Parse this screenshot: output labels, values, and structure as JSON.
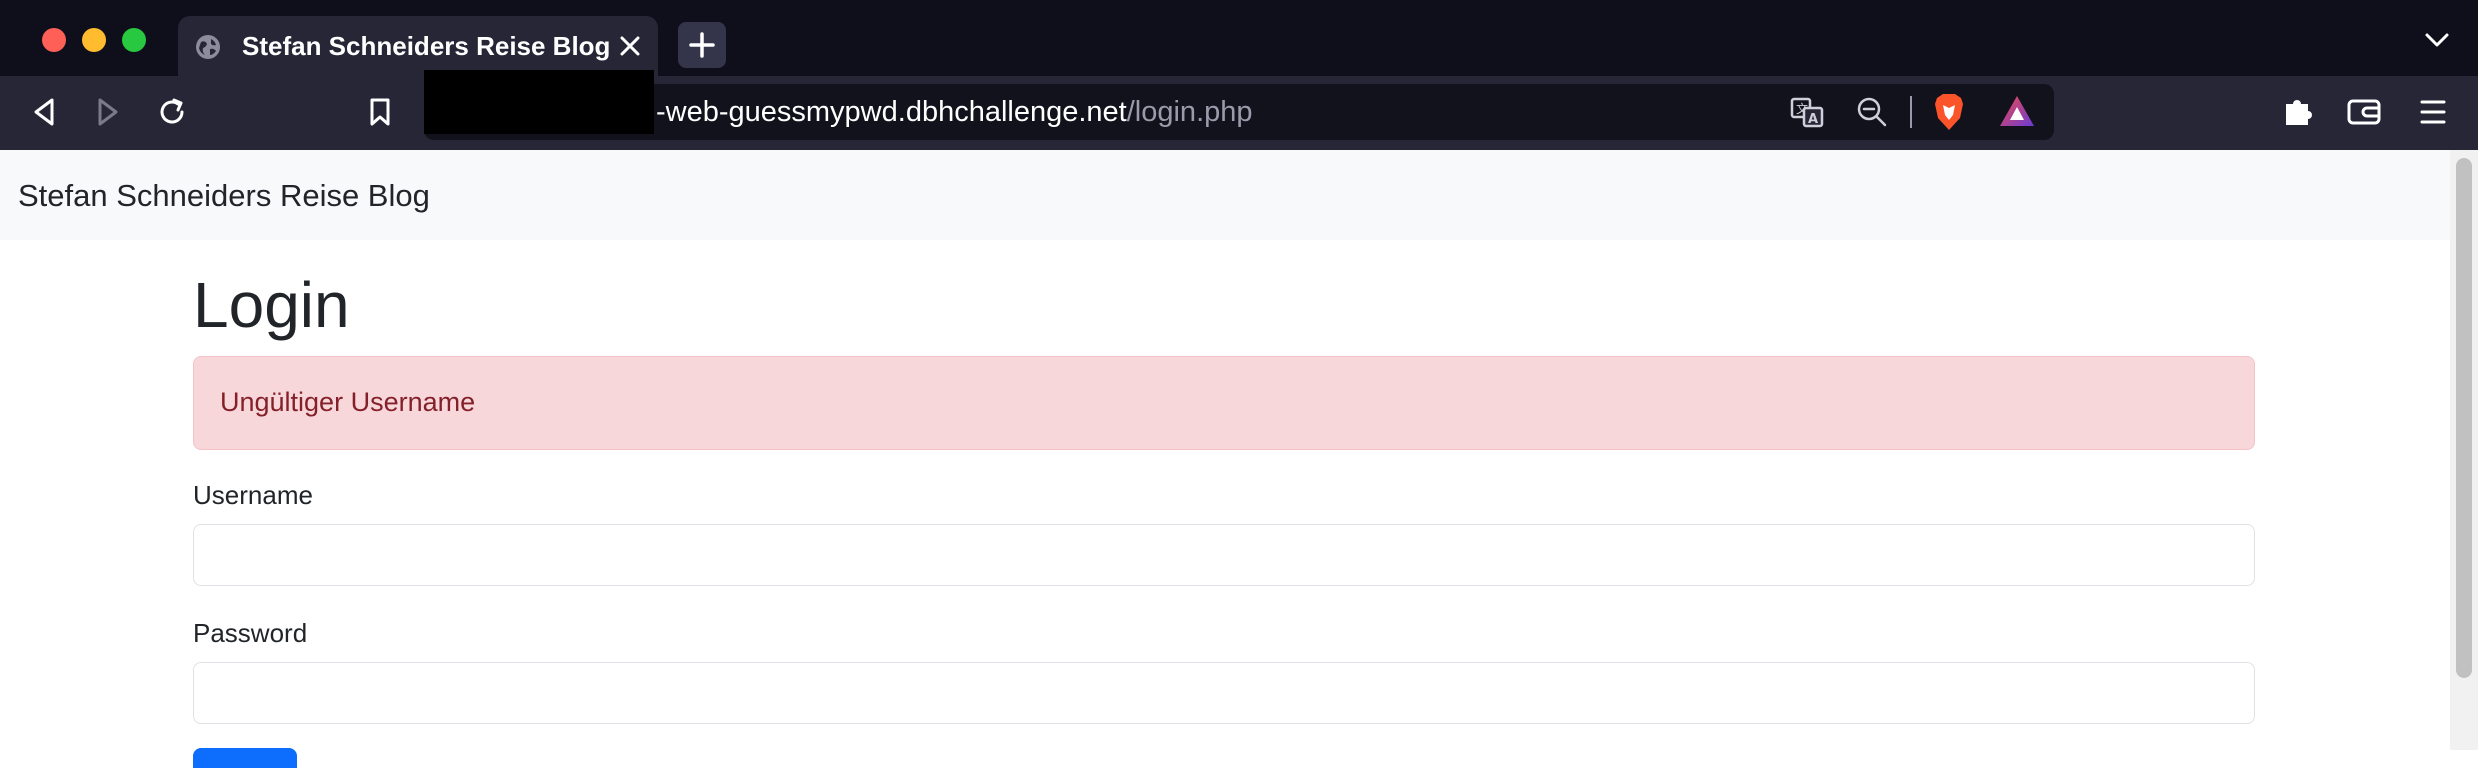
{
  "browser": {
    "tab": {
      "title": "Stefan Schneiders Reise Blog"
    },
    "url": {
      "host": "-web-guessmypwd.dbhchallenge.net",
      "path": "/login.php"
    },
    "icons": {
      "tab_favicon": "globe-icon",
      "tab_close": "close-icon",
      "new_tab": "plus-icon",
      "tab_list": "chevron-down-icon",
      "back": "back-icon",
      "forward": "forward-icon",
      "reload": "reload-icon",
      "bookmark": "bookmark-icon",
      "translate": "translate-icon",
      "zoom": "zoom-out-icon",
      "brave_shields": "brave-shields-icon",
      "brave_rewards": "brave-rewards-icon",
      "extensions": "puzzle-icon",
      "wallet": "wallet-icon",
      "menu": "hamburger-menu-icon"
    }
  },
  "page": {
    "brand": "Stefan Schneiders Reise Blog",
    "heading": "Login",
    "alert": "Ungültiger Username",
    "form": {
      "username_label": "Username",
      "username_value": "",
      "password_label": "Password",
      "password_value": ""
    }
  },
  "colors": {
    "alert_bg": "#f8d7da",
    "alert_text": "#842029",
    "primary": "#0d6efd",
    "chrome_dark": "#0f0f1b",
    "toolbar": "#262637"
  }
}
